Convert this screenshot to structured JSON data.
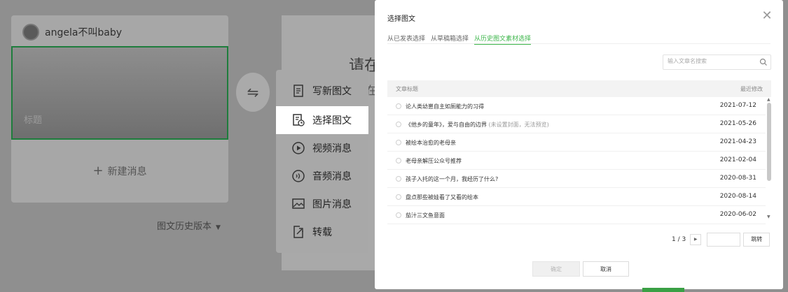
{
  "background": {
    "author": "angela不叫baby",
    "cover_title": "标题",
    "new_message": "新建消息",
    "history_version": "图文历史版本",
    "editor_hint": "请在",
    "editor_sub": "在"
  },
  "type_menu": {
    "items": [
      {
        "label": "写新图文",
        "icon": "document-icon"
      },
      {
        "label": "选择图文",
        "icon": "document-clock-icon"
      },
      {
        "label": "视频消息",
        "icon": "play-circle-icon"
      },
      {
        "label": "音频消息",
        "icon": "audio-icon"
      },
      {
        "label": "图片消息",
        "icon": "image-icon"
      },
      {
        "label": "转载",
        "icon": "share-icon"
      }
    ],
    "selected": "选择图文"
  },
  "modal": {
    "title": "选择图文",
    "tabs": [
      "从已发表选择",
      "从草稿箱选择",
      "从历史图文素材选择"
    ],
    "active_tab": "从历史图文素材选择",
    "search_placeholder": "输入文章名搜索",
    "table": {
      "headers": {
        "title": "文章标题",
        "date": "最近修改"
      },
      "rows": [
        {
          "title": "论人类幼崽自主如厕能力的习得",
          "note": "",
          "date": "2021-07-12"
        },
        {
          "title": "《他乡的童年》，爱与自由的边界",
          "note": "(未设置封面，无法预览)",
          "date": "2021-05-26"
        },
        {
          "title": "被绘本治愈的老母亲",
          "note": "",
          "date": "2021-04-23"
        },
        {
          "title": "老母亲解压公众号推荐",
          "note": "",
          "date": "2021-02-04"
        },
        {
          "title": "孩子入托的这一个月，我经历了什么?",
          "note": "",
          "date": "2020-08-31"
        },
        {
          "title": "盘点那些被娃看了又看的绘本",
          "note": "",
          "date": "2020-08-14"
        },
        {
          "title": "茄汁三文鱼意面",
          "note": "",
          "date": "2020-06-02"
        }
      ]
    },
    "pagination": {
      "current": "1 / 3",
      "jump_label": "跳转"
    },
    "buttons": {
      "confirm": "确定",
      "cancel": "取消"
    }
  },
  "colors": {
    "accent": "#3db64b",
    "overlay": "#8f8f8f"
  }
}
